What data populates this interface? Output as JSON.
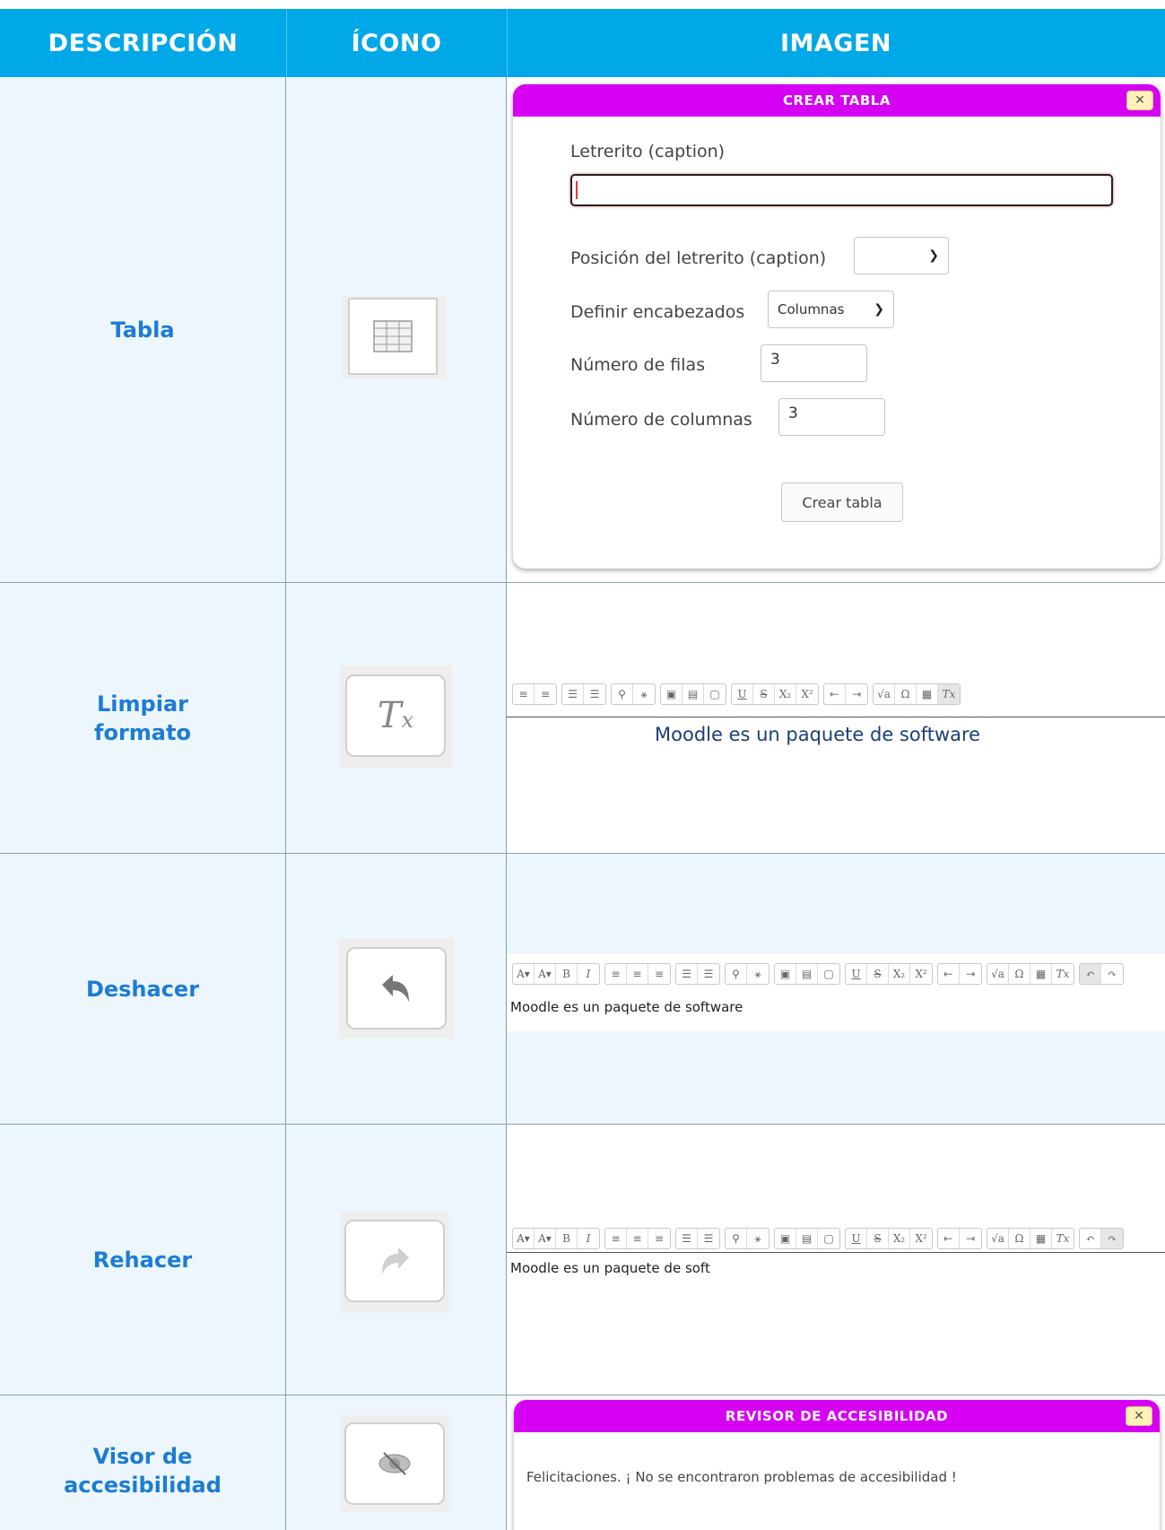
{
  "headers": {
    "description": "DESCRIPCIÓN",
    "icon": "ÍCONO",
    "image": "IMAGEN"
  },
  "colors": {
    "header_bg": "#00A8E8",
    "row_bg": "#ECF6FC",
    "label_blue": "#1C7CD5",
    "dialog_title": "#D600F2"
  },
  "rows": [
    {
      "description": "Tabla",
      "icon": "table-icon",
      "dialog": {
        "title": "CREAR TABLA",
        "close": "✕",
        "caption_label": "Letrerito (caption)",
        "caption_value": "",
        "position_label": "Posición del letrerito (caption)",
        "position_value": "",
        "headers_label": "Definir encabezados",
        "headers_value": "Columnas",
        "rows_label": "Número de filas",
        "rows_value": "3",
        "cols_label": "Número de columnas",
        "cols_value": "3",
        "submit": "Crear tabla"
      }
    },
    {
      "description": "Limpiar\nformato",
      "icon": "clear-format-icon",
      "editor_text": "Moodle es un paquete de software"
    },
    {
      "description": "Deshacer",
      "icon": "undo-icon",
      "editor_text": "Moodle es un paquete de software"
    },
    {
      "description": "Rehacer",
      "icon": "redo-icon",
      "editor_text": "Moodle es un paquete de soft"
    },
    {
      "description": "Visor de\naccesibilidad",
      "icon": "accessibility-icon",
      "dialog": {
        "title": "REVISOR DE ACCESIBILIDAD",
        "close": "✕",
        "message": "Felicitaciones. ¡ No se encontraron problemas de accesibilidad !"
      }
    }
  ],
  "toolbar_glyphs": {
    "font_color": "A▾",
    "bg_color": "A▾",
    "bold": "B",
    "italic": "I",
    "underline": "U",
    "strike": "S",
    "subscript": "X₂",
    "superscript": "X²",
    "equation": "√a",
    "omega": "Ω",
    "clear": "Tx",
    "undo": "↶",
    "redo": "↷"
  }
}
